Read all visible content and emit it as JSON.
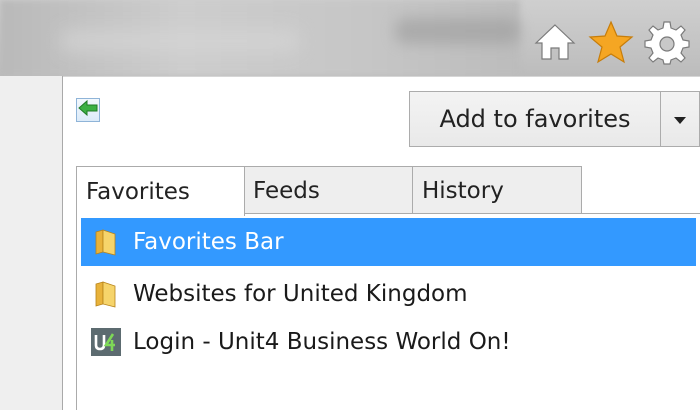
{
  "panel": {
    "add_to_favorites_label": "Add to favorites"
  },
  "tabs": [
    {
      "label": "Favorites",
      "active": true
    },
    {
      "label": "Feeds",
      "active": false
    },
    {
      "label": "History",
      "active": false
    }
  ],
  "favorites": [
    {
      "label": "Favorites Bar",
      "icon": "folder-icon",
      "selected": true
    },
    {
      "label": "Websites for United Kingdom",
      "icon": "folder-icon",
      "selected": false
    },
    {
      "label": "Login - Unit4 Business World On!",
      "icon": "unit4-favicon",
      "selected": false
    }
  ],
  "colors": {
    "selection": "#3399ff",
    "star": "#f5a623",
    "folder": "#f2c94c"
  }
}
